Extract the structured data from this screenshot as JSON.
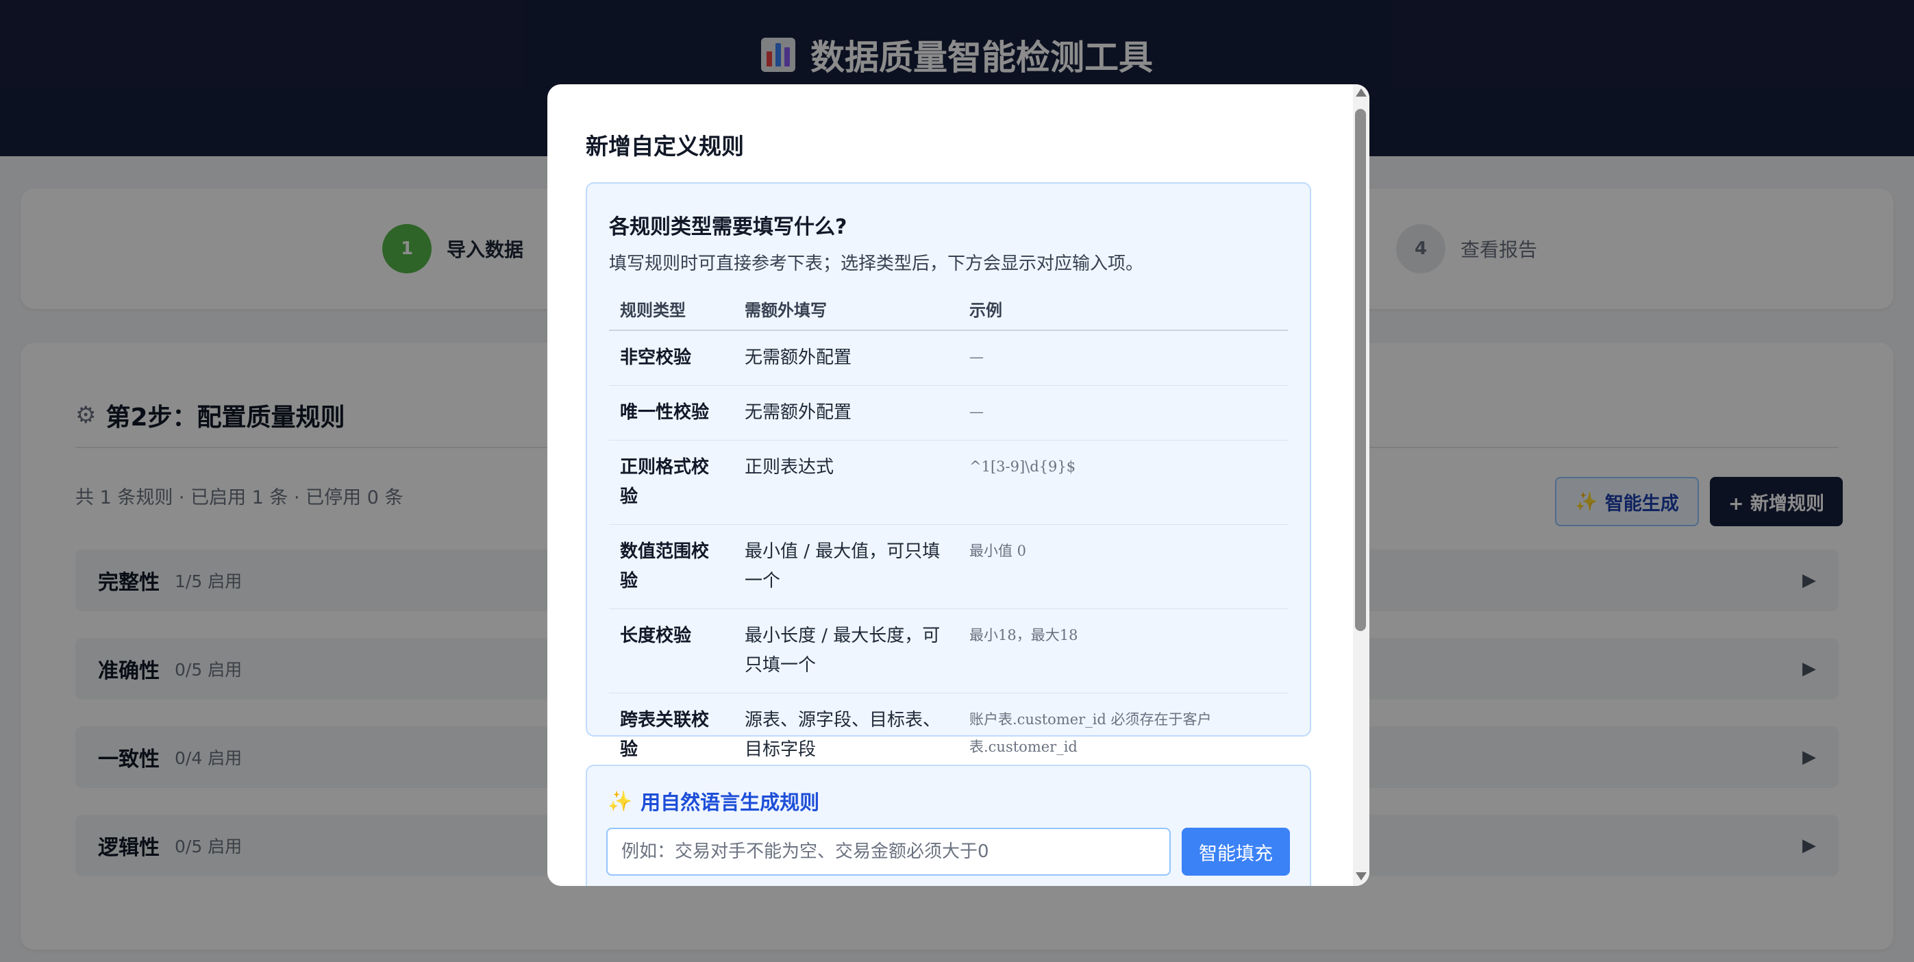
{
  "app": {
    "title": "数据质量智能检测工具",
    "logo_icon": "bar-chart-icon"
  },
  "stepper": {
    "steps": [
      {
        "number": "1",
        "label": "导入数据",
        "state": "done",
        "color": "#54b648"
      },
      {
        "number": "4",
        "label": "查看报告",
        "state": "pending",
        "color": "#e5e7eb"
      }
    ]
  },
  "rules_page": {
    "title": "第2步：配置质量规则",
    "title_icon": "gear-icon",
    "summary": "共 1 条规则 · 已启用 1 条 · 已停用 0 条",
    "ai_button": "智能生成",
    "add_button": "+ 新增规则",
    "groups": [
      {
        "name": "完整性",
        "count": "1/5 启用"
      },
      {
        "name": "准确性",
        "count": "0/5 启用"
      },
      {
        "name": "一致性",
        "count": "0/4 启用"
      },
      {
        "name": "逻辑性",
        "count": "0/5 启用"
      }
    ]
  },
  "modal": {
    "title": "新增自定义规则",
    "help": {
      "title": "各规则类型需要填写什么?",
      "desc": "填写规则时可直接参考下表；选择类型后，下方会显示对应输入项。",
      "headers": [
        "规则类型",
        "需额外填写",
        "示例"
      ],
      "rows": [
        {
          "type": "非空校验",
          "fields": "无需额外配置",
          "example": "—"
        },
        {
          "type": "唯一性校验",
          "fields": "无需额外配置",
          "example": "—"
        },
        {
          "type": "正则格式校验",
          "fields": "正则表达式",
          "example": "^1[3-9]\\d{9}$"
        },
        {
          "type": "数值范围校验",
          "fields": "最小值 / 最大值，可只填一个",
          "example": "最小值 0"
        },
        {
          "type": "长度校验",
          "fields": "最小长度 / 最大长度，可只填一个",
          "example": "最小18，最大18"
        },
        {
          "type": "跨表关联校验",
          "fields": "源表、源字段、目标表、目标字段",
          "example": "账户表.customer_id 必须存在于客户表.customer_id"
        }
      ]
    },
    "nl": {
      "title": "用自然语言生成规则",
      "placeholder": "例如：交易对手不能为空、交易金额必须大于0",
      "button": "智能填充"
    }
  },
  "colors": {
    "header_bg": "#171f3d",
    "accent_blue": "#3b82f6",
    "success_green": "#54b648"
  }
}
